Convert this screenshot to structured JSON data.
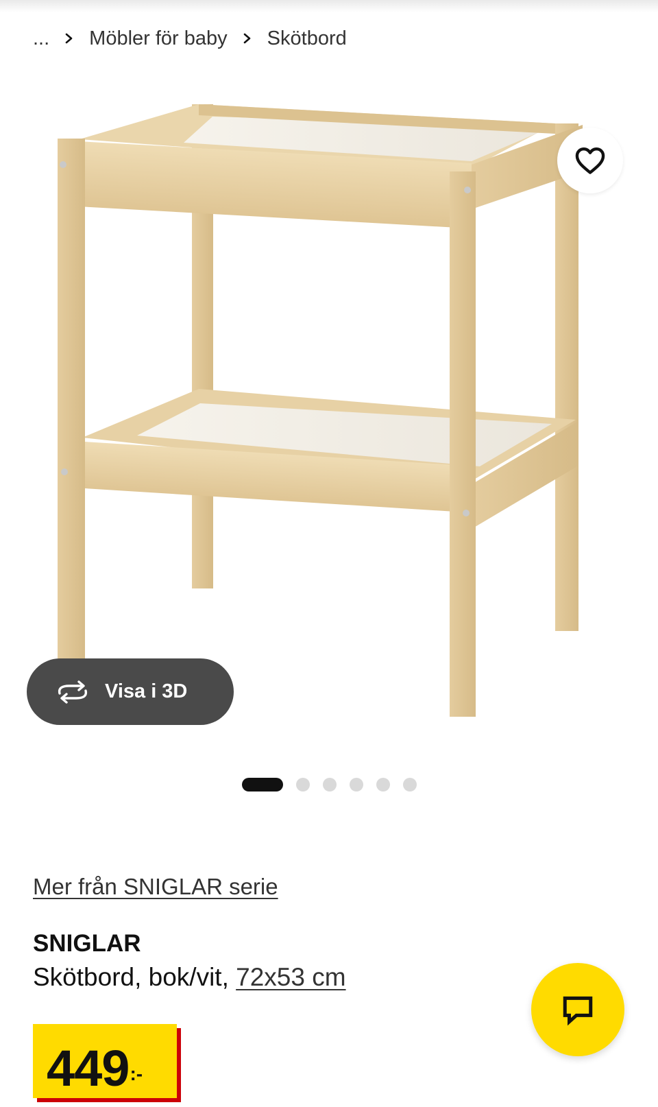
{
  "breadcrumb": {
    "ellipsis": "...",
    "items": [
      "Möbler för baby",
      "Skötbord"
    ]
  },
  "product_image": {
    "alt": "SNIGLAR"
  },
  "favorite": {
    "icon": "heart-icon"
  },
  "view_3d": {
    "label": "Visa i 3D",
    "icon": "rotate-3d-icon"
  },
  "carousel": {
    "total": 6,
    "active": 1
  },
  "product": {
    "series_link": "Mer från SNIGLAR serie",
    "name": "SNIGLAR",
    "description": "Skötbord, bok/vit, ",
    "size": "72x53 cm",
    "price_integer": "449",
    "price_suffix": ":-"
  },
  "chat": {
    "icon": "chat-icon"
  },
  "colors": {
    "price_background": "#ffdb00",
    "price_shadow": "#cc0008",
    "view3d_background": "#4a4a4a",
    "wood": "#e8d4a8"
  }
}
